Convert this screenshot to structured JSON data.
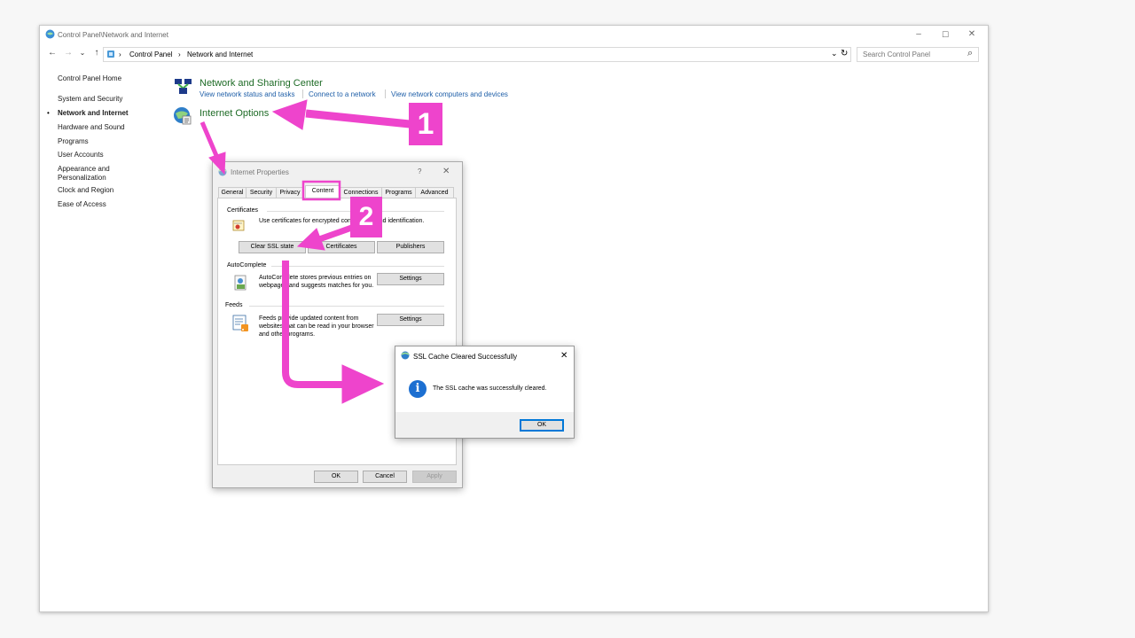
{
  "window": {
    "title": "Control Panel\\Network and Internet",
    "minimize": "–",
    "maximize": "☐",
    "close": "✕"
  },
  "address": {
    "back": "←",
    "forward": "→",
    "recent": "⌄",
    "up": "↑",
    "sep1": "›",
    "crumb1": "Control Panel",
    "sep2": "›",
    "crumb2": "Network and Internet",
    "dropdown": "⌄",
    "refresh": "↻",
    "search_placeholder": "Search Control Panel",
    "search_icon": "⌕"
  },
  "sidebar": {
    "items": [
      {
        "label": "Control Panel Home"
      },
      {
        "label": "System and Security"
      },
      {
        "label": "Network and Internet",
        "active": true
      },
      {
        "label": "Hardware and Sound"
      },
      {
        "label": "Programs"
      },
      {
        "label": "User Accounts"
      },
      {
        "label": "Appearance and Personalization"
      },
      {
        "label": "Clock and Region"
      },
      {
        "label": "Ease of Access"
      }
    ],
    "bullet": "•"
  },
  "categories": {
    "network": {
      "title": "Network and Sharing Center",
      "links": [
        "View network status and tasks",
        "Connect to a network",
        "View network computers and devices"
      ]
    },
    "internet": {
      "title": "Internet Options"
    }
  },
  "dialog": {
    "title": "Internet Properties",
    "help": "?",
    "close": "✕",
    "tabs": [
      "General",
      "Security",
      "Privacy",
      "Content",
      "Connections",
      "Programs",
      "Advanced"
    ],
    "certificates": {
      "heading": "Certificates",
      "text": "Use certificates for encrypted connections and identification.",
      "buttons": [
        "Clear SSL state",
        "Certificates",
        "Publishers"
      ]
    },
    "autocomplete": {
      "heading": "AutoComplete",
      "text": "AutoComplete stores previous entries on webpages and suggests matches for you.",
      "button": "Settings"
    },
    "feeds": {
      "heading": "Feeds",
      "text": "Feeds provide updated content from websites that can be read in your browser and other programs.",
      "button": "Settings"
    },
    "footer": {
      "ok": "OK",
      "cancel": "Cancel",
      "apply": "Apply"
    }
  },
  "msgbox": {
    "title": "SSL Cache Cleared Successfully",
    "close": "✕",
    "icon_glyph": "i",
    "message": "The SSL cache was successfully cleared.",
    "ok": "OK"
  },
  "annotations": {
    "step1": "1",
    "step2": "2",
    "color": "#ee44cc"
  }
}
